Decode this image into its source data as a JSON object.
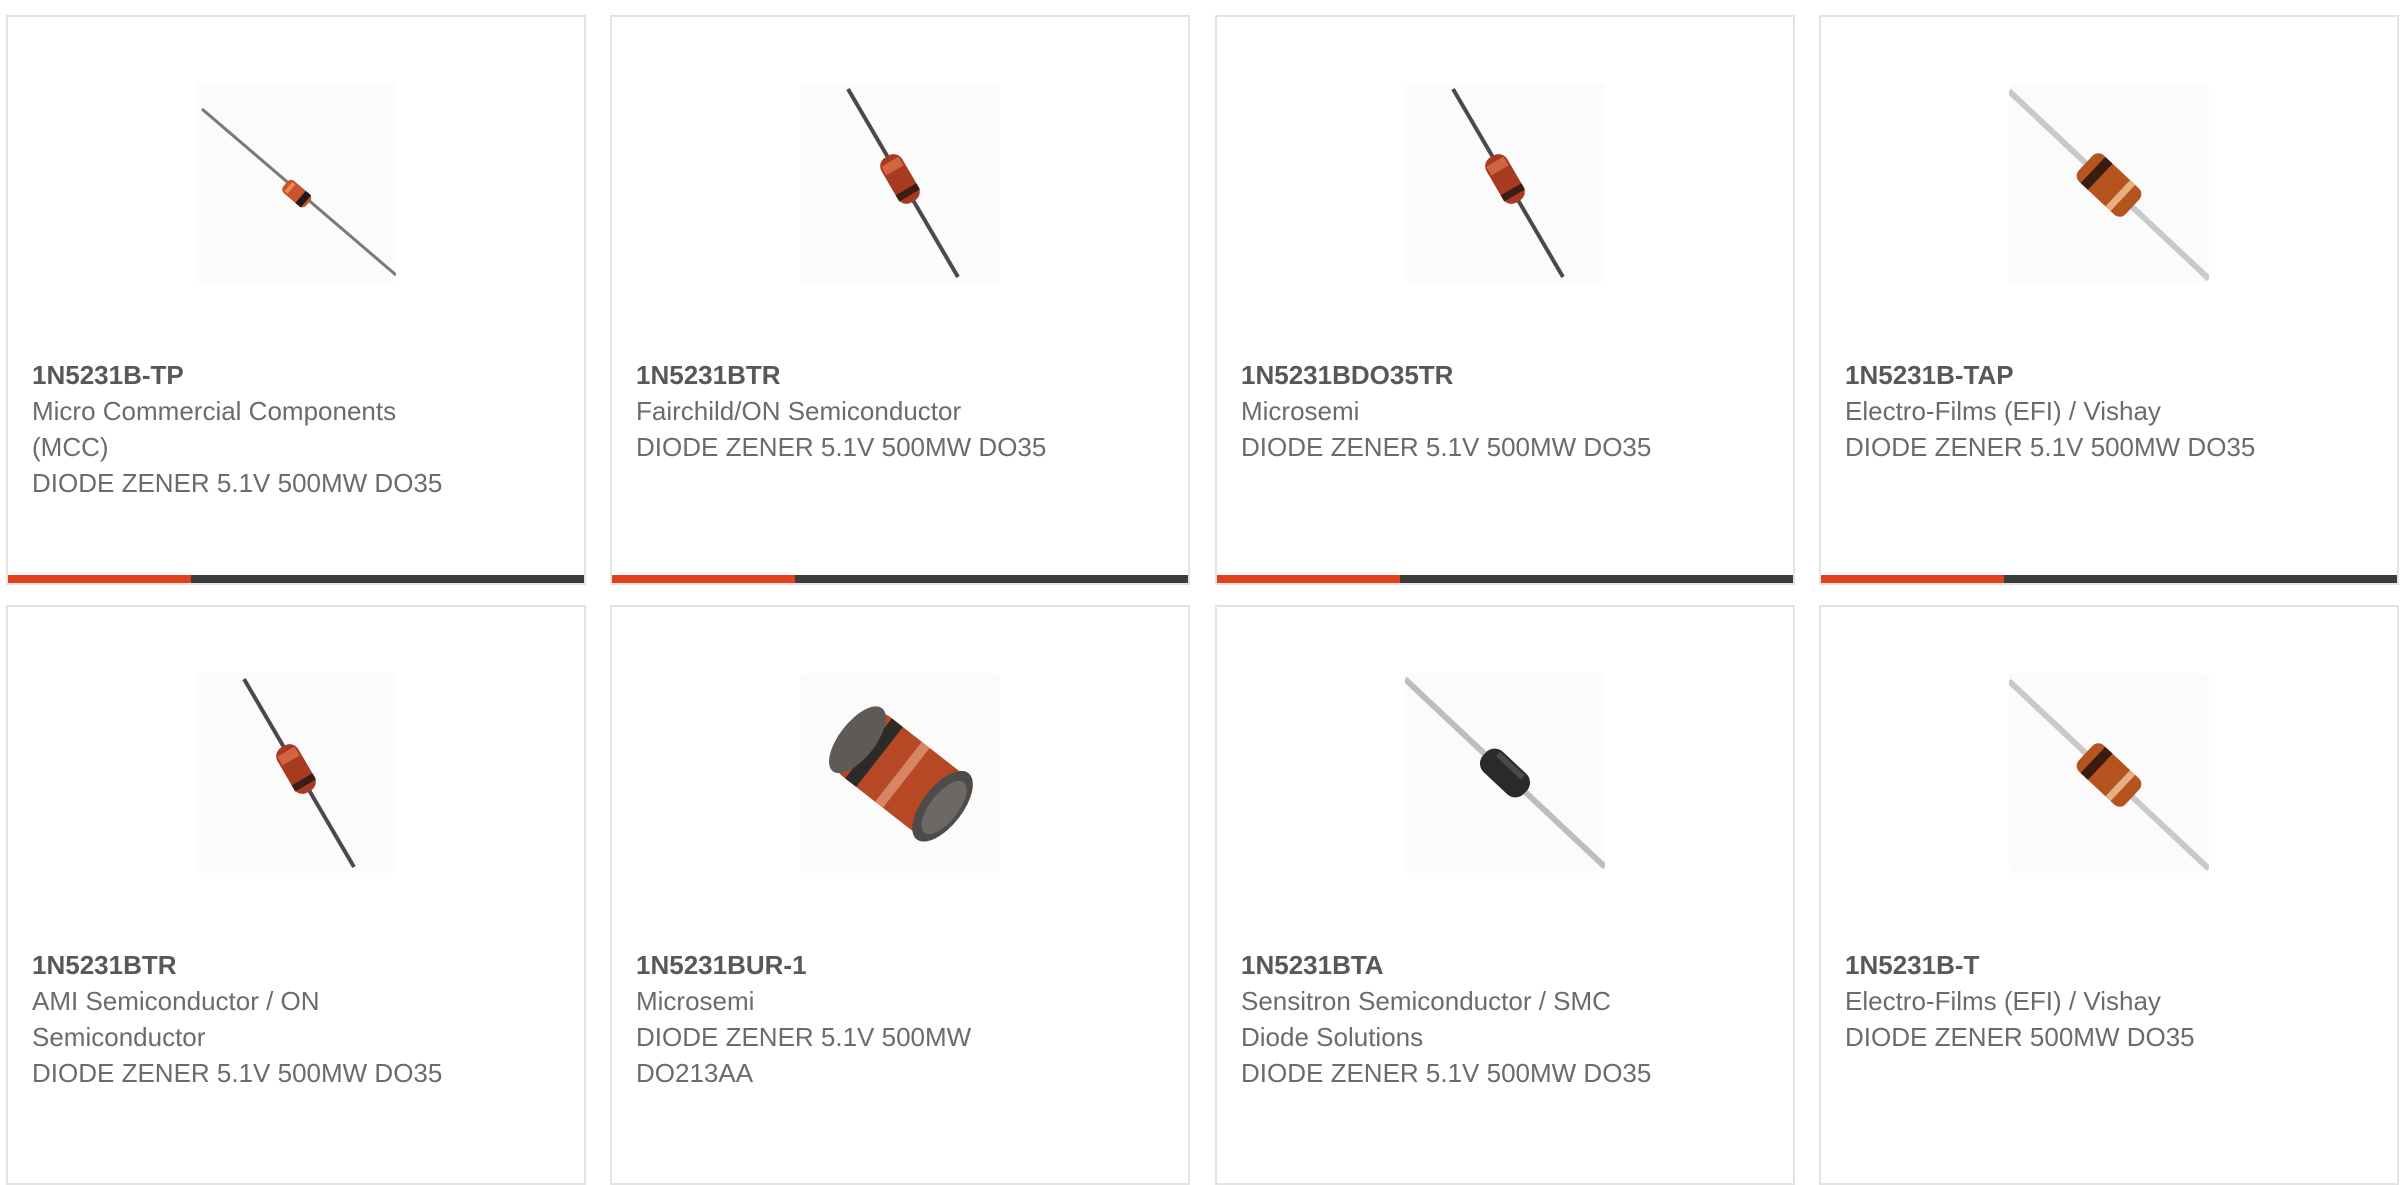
{
  "colors": {
    "accent": "#e0401a",
    "bar_dark": "#3c3c3c",
    "card_border": "#e3e3e3",
    "text": "#6b6b6b",
    "part_text": "#585858"
  },
  "products": [
    {
      "part": "1N5231B-TP",
      "manufacturer": "Micro Commercial Components (MCC)",
      "description": "DIODE ZENER 5.1V 500MW DO35",
      "image": "small-axial-diode-glass-orange-icon"
    },
    {
      "part": "1N5231BTR",
      "manufacturer": "Fairchild/ON Semiconductor",
      "description": "DIODE ZENER 5.1V 500MW DO35",
      "image": "axial-diode-glass-red-icon"
    },
    {
      "part": "1N5231BDO35TR",
      "manufacturer": "Microsemi",
      "description": "DIODE ZENER 5.1V 500MW DO35",
      "image": "axial-diode-glass-red-icon"
    },
    {
      "part": "1N5231B-TAP",
      "manufacturer": "Electro-Films (EFI) / Vishay",
      "description": "DIODE ZENER 5.1V 500MW DO35",
      "image": "axial-diode-orange-body-icon"
    },
    {
      "part": "1N5231BTR",
      "manufacturer": "AMI Semiconductor / ON Semiconductor",
      "description": "DIODE ZENER 5.1V 500MW DO35",
      "image": "axial-diode-glass-red-icon"
    },
    {
      "part": "1N5231BUR-1",
      "manufacturer": "Microsemi",
      "description": "DIODE ZENER 5.1V 500MW DO213AA",
      "image": "melf-diode-icon"
    },
    {
      "part": "1N5231BTA",
      "manufacturer": "Sensitron Semiconductor / SMC Diode Solutions",
      "description": "DIODE ZENER 5.1V 500MW DO35",
      "image": "axial-diode-black-body-icon"
    },
    {
      "part": "1N5231B-T",
      "manufacturer": "Electro-Films (EFI) / Vishay",
      "description": "DIODE ZENER 500MW DO35",
      "image": "axial-diode-orange-body-icon"
    }
  ]
}
